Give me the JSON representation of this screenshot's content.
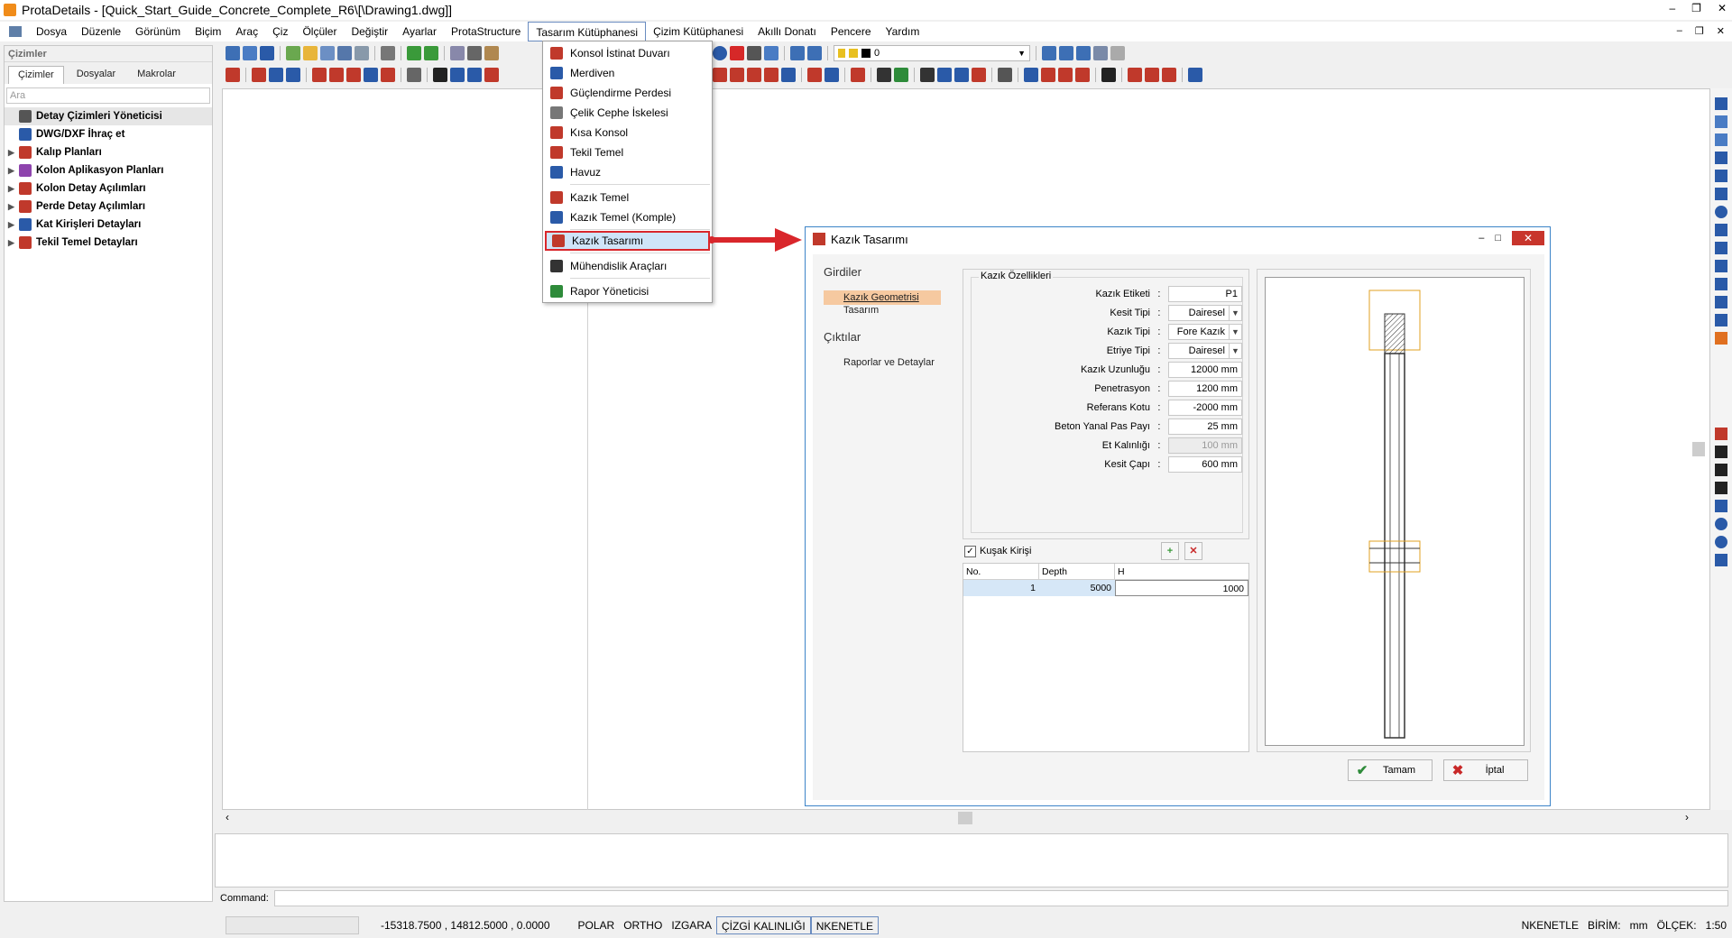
{
  "window": {
    "title": "ProtaDetails - [Quick_Start_Guide_Concrete_Complete_R6\\[\\Drawing1.dwg]]",
    "controls": [
      "–",
      "❐",
      "✕"
    ]
  },
  "menubar": {
    "items": [
      "Dosya",
      "Düzenle",
      "Görünüm",
      "Biçim",
      "Araç",
      "Çiz",
      "Ölçüler",
      "Değiştir",
      "Ayarlar",
      "ProtaStructure",
      "Tasarım Kütüphanesi",
      "Çizim Kütüphanesi",
      "Akıllı Donatı",
      "Pencere",
      "Yardım"
    ],
    "active_index": 10,
    "mdi_controls": [
      "–",
      "❐",
      "✕"
    ]
  },
  "toolbar": {
    "layer_value": "0"
  },
  "left_panel": {
    "title": "Çizimler",
    "tabs": [
      "Çizimler",
      "Dosyalar",
      "Makrolar"
    ],
    "search_placeholder": "Ara",
    "tree": [
      {
        "label": "Detay Çizimleri Yöneticisi",
        "expandable": false,
        "icon_color": "#555555"
      },
      {
        "label": "DWG/DXF İhraç et",
        "expandable": false,
        "icon_color": "#2a5aa8"
      },
      {
        "label": "Kalıp Planları",
        "expandable": true,
        "icon_color": "#c0392b"
      },
      {
        "label": "Kolon Aplikasyon Planları",
        "expandable": true,
        "icon_color": "#8e44ad"
      },
      {
        "label": "Kolon Detay Açılımları",
        "expandable": true,
        "icon_color": "#c0392b"
      },
      {
        "label": "Perde Detay Açılımları",
        "expandable": true,
        "icon_color": "#c0392b"
      },
      {
        "label": "Kat Kirişleri Detayları",
        "expandable": true,
        "icon_color": "#2a5aa8"
      },
      {
        "label": "Tekil Temel Detayları",
        "expandable": true,
        "icon_color": "#c0392b"
      }
    ]
  },
  "dropdown": {
    "items": [
      {
        "label": "Konsol İstinat Duvarı",
        "icon_color": "#c0392b"
      },
      {
        "label": "Merdiven",
        "icon_color": "#2a5aa8"
      },
      {
        "label": "Güçlendirme Perdesi",
        "icon_color": "#c0392b"
      },
      {
        "label": "Çelik Cephe İskelesi",
        "icon_color": "#777777"
      },
      {
        "label": "Kısa Konsol",
        "icon_color": "#c0392b"
      },
      {
        "label": "Tekil Temel",
        "icon_color": "#c0392b"
      },
      {
        "label": "Havuz",
        "icon_color": "#2a5aa8"
      },
      {
        "label": "Kazık Temel",
        "icon_color": "#c0392b"
      },
      {
        "label": "Kazık Temel (Komple)",
        "icon_color": "#2a5aa8"
      },
      {
        "label": "Kazık Tasarımı",
        "icon_color": "#c0392b"
      },
      {
        "label": "Mühendislik Araçları",
        "icon_color": "#333333"
      },
      {
        "label": "Rapor Yöneticisi",
        "icon_color": "#2e8b3a"
      }
    ],
    "highlight_index": 9
  },
  "dialog": {
    "title": "Kazık Tasarımı",
    "nav": {
      "inputs_heading": "Girdiler",
      "input_links": [
        "Kazık Geometrisi",
        "Tasarım"
      ],
      "outputs_heading": "Çıktılar",
      "output_links": [
        "Raporlar ve Detaylar"
      ]
    },
    "properties": {
      "group_title": "Kazık Özellikleri",
      "fields": [
        {
          "label": "Kazık Etiketi",
          "value": "P1",
          "kind": "text"
        },
        {
          "label": "Kesit Tipi",
          "value": "Dairesel",
          "kind": "select"
        },
        {
          "label": "Kazık Tipi",
          "value": "Fore Kazık",
          "kind": "select"
        },
        {
          "label": "Etriye Tipi",
          "value": "Dairesel",
          "kind": "select"
        },
        {
          "label": "Kazık Uzunluğu",
          "value": "12000 mm",
          "kind": "text"
        },
        {
          "label": "Penetrasyon",
          "value": "1200 mm",
          "kind": "text"
        },
        {
          "label": "Referans Kotu",
          "value": "-2000 mm",
          "kind": "text"
        },
        {
          "label": "Beton Yanal Pas Payı",
          "value": "25 mm",
          "kind": "text"
        },
        {
          "label": "Et Kalınlığı",
          "value": "100 mm",
          "kind": "disabled"
        },
        {
          "label": "Kesit Çapı",
          "value": "600 mm",
          "kind": "text"
        }
      ]
    },
    "belt_beam": {
      "label": "Kuşak Kirişi",
      "checked": true,
      "columns": [
        "No.",
        "Depth",
        "H"
      ],
      "rows": [
        [
          "1",
          "5000",
          "1000"
        ]
      ]
    },
    "buttons": {
      "ok": "Tamam",
      "cancel": "İptal"
    }
  },
  "command": {
    "label": "Command:"
  },
  "status": {
    "coords": "-15318.7500 , 14812.5000 , 0.0000",
    "toggles": [
      {
        "label": "POLAR",
        "on": false
      },
      {
        "label": "ORTHO",
        "on": false
      },
      {
        "label": "IZGARA",
        "on": false
      },
      {
        "label": "ÇİZGİ KALINLIĞI",
        "on": true
      },
      {
        "label": "NKENETLE",
        "on": true
      }
    ],
    "right": {
      "snap": "NKENETLE",
      "unit_label": "BİRİM:",
      "unit": "mm",
      "scale_label": "ÖLÇEK:",
      "scale": "1:50"
    }
  },
  "colors": {
    "accent_blue": "#3c84c8",
    "highlight_red": "#d9262b",
    "menu_highlight": "#cfe4f8",
    "nav_active": "#f6c9a0"
  }
}
